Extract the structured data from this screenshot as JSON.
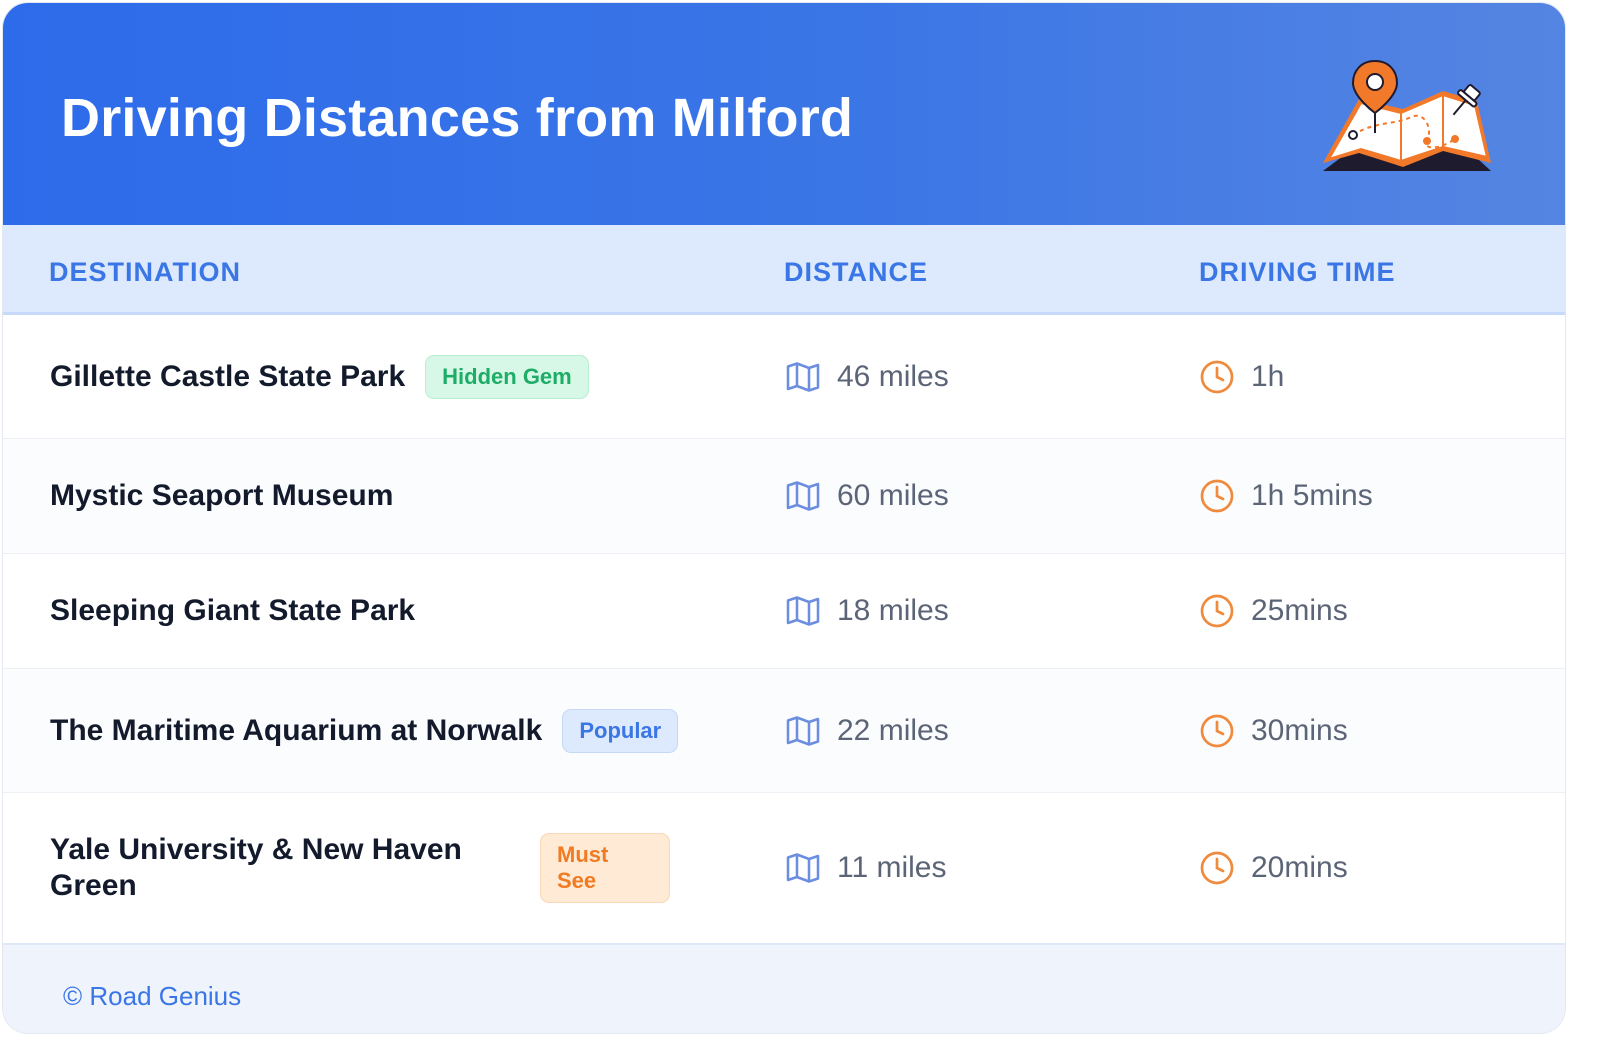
{
  "header": {
    "title": "Driving Distances from Milford",
    "illustration_icon": "map-with-pins-icon"
  },
  "table": {
    "columns": [
      "DESTINATION",
      "DISTANCE",
      "DRIVING TIME"
    ],
    "rows": [
      {
        "destination": "Gillette Castle State Park",
        "badge": "Hidden Gem",
        "badge_color": "green",
        "distance": "46 miles",
        "time": "1h"
      },
      {
        "destination": "Mystic Seaport Museum",
        "badge": "",
        "badge_color": "",
        "distance": "60 miles",
        "time": "1h 5mins"
      },
      {
        "destination": "Sleeping Giant State Park",
        "badge": "",
        "badge_color": "",
        "distance": "18 miles",
        "time": "25mins"
      },
      {
        "destination": "The Maritime Aquarium at Norwalk",
        "badge": "Popular",
        "badge_color": "blue",
        "distance": "22 miles",
        "time": "30mins"
      },
      {
        "destination": "Yale University & New Haven Green",
        "badge": "Must See",
        "badge_color": "orange",
        "distance": "11 miles",
        "time": "20mins"
      }
    ],
    "distance_icon": "map-icon",
    "time_icon": "clock-icon"
  },
  "footer": {
    "credit": "© Road Genius"
  },
  "colors": {
    "header_start": "#2d6bea",
    "header_end": "#5585e2",
    "accent_blue": "#3b76e6",
    "accent_orange": "#f07b22",
    "badge_green": "#1ead67"
  }
}
